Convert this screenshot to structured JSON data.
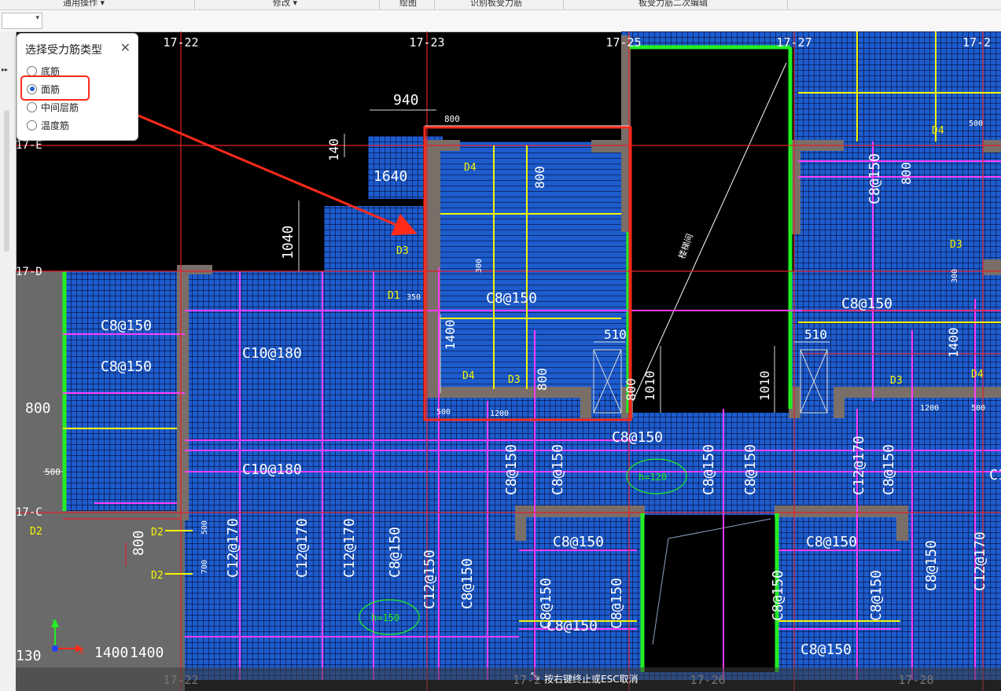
{
  "top_menu": {
    "items": [
      "通用操作 ▾",
      "修改 ▾",
      "绘图",
      "识别板受力筋",
      "板受力筋二次编辑"
    ]
  },
  "axis_labels": {
    "top": [
      "17-22",
      "17-23",
      "17-25",
      "17-27",
      "17-2"
    ],
    "bottom": [
      "17-22",
      "17-2",
      "17-26",
      "17-28"
    ],
    "left": [
      "17-E",
      "17-D",
      "17-C"
    ]
  },
  "dims": [
    "940",
    "800",
    "140",
    "1640",
    "1040",
    "1400",
    "800",
    "510",
    "800",
    "1010",
    "1010",
    "510",
    "800",
    "1400",
    "500",
    "1200",
    "350",
    "300",
    "800",
    "500",
    "500",
    "1200",
    "500",
    "800",
    "700",
    "500",
    "1400",
    "130",
    "300"
  ],
  "rebar_labels": [
    "C8@150",
    "C8@150",
    "C8@150",
    "C10@180",
    "C10@180",
    "C8@150",
    "C8@150",
    "C8@150",
    "C8@150",
    "C8@150",
    "C8@150",
    "C12@170",
    "C12@170",
    "C12@170",
    "C12@170",
    "C8@150",
    "C12@150",
    "C8@150",
    "C8@150",
    "C8@150",
    "C8@150",
    "C8@150",
    "C8@150",
    "C8@150",
    "C8@150",
    "C8@150",
    "C12@170",
    "C8@150",
    "C8@150",
    "C8@150",
    "C10"
  ],
  "marks": [
    "D4",
    "D3",
    "D1",
    "D4",
    "D3",
    "D4",
    "D3",
    "D4",
    "D3",
    "D2",
    "D2",
    "D2"
  ],
  "circle_labels": [
    "h=120",
    "h=150"
  ],
  "misc_labels": [
    "楼梯间",
    "800",
    "1400"
  ],
  "dialog": {
    "title": "选择受力筋类型",
    "options": [
      "底筋",
      "面筋",
      "中间层筋",
      "温度筋"
    ],
    "selected": "面筋"
  },
  "status": {
    "text": "按右键终止或ESC取消"
  },
  "colors": {
    "slab_fill": "#1c5ccd",
    "rebar_magenta": "#ff3cff",
    "rebar_yellow": "#f5f500",
    "wall": "#7a6e68",
    "highlight_red": "#ff2a1a",
    "green_beam": "#22ee22"
  }
}
